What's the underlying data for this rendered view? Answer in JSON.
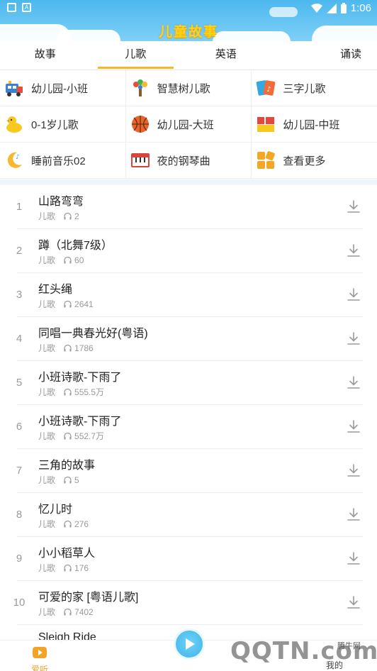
{
  "status_bar": {
    "time": "1:06"
  },
  "app": {
    "title": "儿童故事"
  },
  "tabs": [
    {
      "label": "故事"
    },
    {
      "label": "儿歌",
      "active": true
    },
    {
      "label": "英语"
    },
    {
      "label": "诵读"
    }
  ],
  "categories": [
    {
      "label": "幼儿园-小班",
      "icon": "train-icon"
    },
    {
      "label": "智慧树儿歌",
      "icon": "tree-icon"
    },
    {
      "label": "三字儿歌",
      "icon": "music-cards-icon"
    },
    {
      "label": "0-1岁儿歌",
      "icon": "duck-icon"
    },
    {
      "label": "幼儿园-大班",
      "icon": "basketball-icon"
    },
    {
      "label": "幼儿园-中班",
      "icon": "blocks-icon"
    },
    {
      "label": "睡前音乐02",
      "icon": "moon-icon"
    },
    {
      "label": "夜的钢琴曲",
      "icon": "piano-icon"
    },
    {
      "label": "查看更多",
      "icon": "more-grid-icon"
    }
  ],
  "songs": [
    {
      "num": "1",
      "title": "山路弯弯",
      "tag": "儿歌",
      "plays": "2"
    },
    {
      "num": "2",
      "title": "蹲（北舞7级）",
      "tag": "儿歌",
      "plays": "60"
    },
    {
      "num": "3",
      "title": "红头绳",
      "tag": "儿歌",
      "plays": "2641"
    },
    {
      "num": "4",
      "title": "同唱一典春光好(粤语)",
      "tag": "儿歌",
      "plays": "1786"
    },
    {
      "num": "5",
      "title": "小班诗歌-下雨了",
      "tag": "儿歌",
      "plays": "555.5万"
    },
    {
      "num": "6",
      "title": "小班诗歌-下雨了",
      "tag": "儿歌",
      "plays": "552.7万"
    },
    {
      "num": "7",
      "title": "三角的故事",
      "tag": "儿歌",
      "plays": "5"
    },
    {
      "num": "8",
      "title": "忆儿时",
      "tag": "儿歌",
      "plays": "276"
    },
    {
      "num": "9",
      "title": "小小稻草人",
      "tag": "儿歌",
      "plays": "176"
    },
    {
      "num": "10",
      "title": "可爱的家 [粤语儿歌]",
      "tag": "儿歌",
      "plays": "7402"
    }
  ],
  "partial_song": {
    "title": "Sleigh Ride"
  },
  "bottom_nav": {
    "home": "爱听",
    "mine": "我的"
  },
  "watermark": {
    "text": "QQTN.com",
    "cn": "腾牛网"
  },
  "colors": {
    "header": "#4cb8ee",
    "accent": "#f1b830",
    "title": "#ffd21a"
  }
}
